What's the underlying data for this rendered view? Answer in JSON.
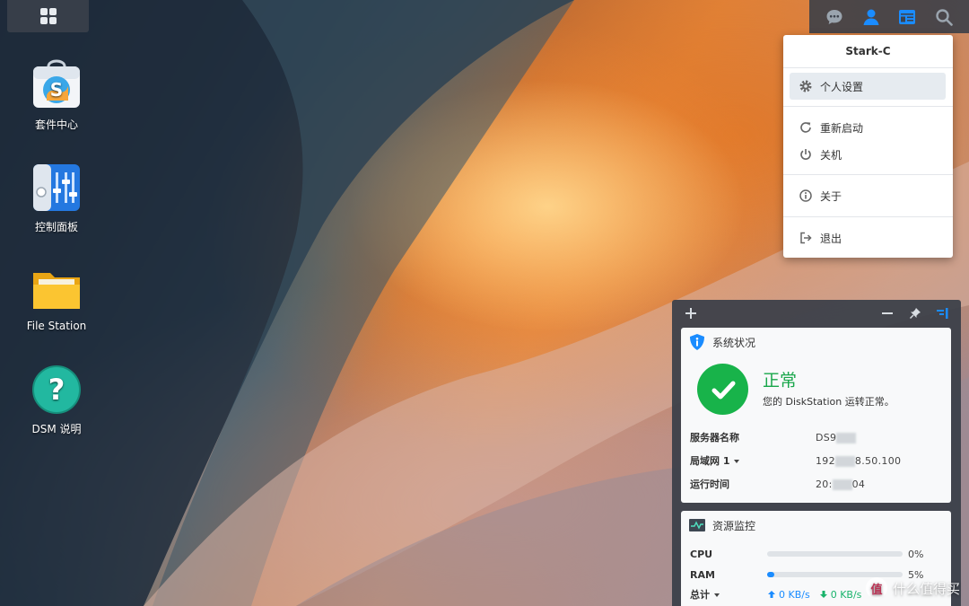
{
  "desktop": {
    "icons": [
      {
        "label": "套件中心",
        "icon": "package-center-icon"
      },
      {
        "label": "控制面板",
        "icon": "control-panel-icon"
      },
      {
        "label": "File Station",
        "icon": "file-station-icon"
      },
      {
        "label": "DSM 说明",
        "icon": "help-icon"
      }
    ]
  },
  "taskbar": {
    "main_menu_icon": "grid-icon",
    "tray_icons": [
      "chat-icon",
      "user-icon",
      "widgets-icon",
      "search-icon"
    ],
    "active_tray": "user-icon"
  },
  "user_menu": {
    "username": "Stark-C",
    "items": [
      {
        "label": "个人设置",
        "icon": "gear-icon"
      },
      {
        "label": "重新启动",
        "icon": "restart-icon"
      },
      {
        "label": "关机",
        "icon": "power-icon"
      },
      {
        "label": "关于",
        "icon": "info-icon"
      },
      {
        "label": "退出",
        "icon": "logout-icon"
      }
    ]
  },
  "widgets": {
    "system_status": {
      "title": "系统状况",
      "status": "正常",
      "message": "您的 DiskStation 运转正常。",
      "rows": [
        {
          "key": "服务器名称",
          "value_prefix": "DS9",
          "value_suffix": ""
        },
        {
          "key": "局域网 1",
          "value_prefix": "192",
          "value_suffix": "8.50.100"
        },
        {
          "key": "运行时间",
          "value_prefix": "20:",
          "value_suffix": "04"
        }
      ]
    },
    "resource_monitor": {
      "title": "资源监控",
      "cpu_label": "CPU",
      "cpu_value": "0%",
      "cpu_fraction": 0.0,
      "ram_label": "RAM",
      "ram_value": "5%",
      "ram_fraction": 0.05,
      "total_label": "总计",
      "upload": "0 KB/s",
      "download": "0 KB/s"
    }
  },
  "watermark": {
    "badge": "值",
    "text": "什么值得买"
  },
  "colors": {
    "accent": "#1a8cff",
    "ok_green": "#18b34a"
  }
}
